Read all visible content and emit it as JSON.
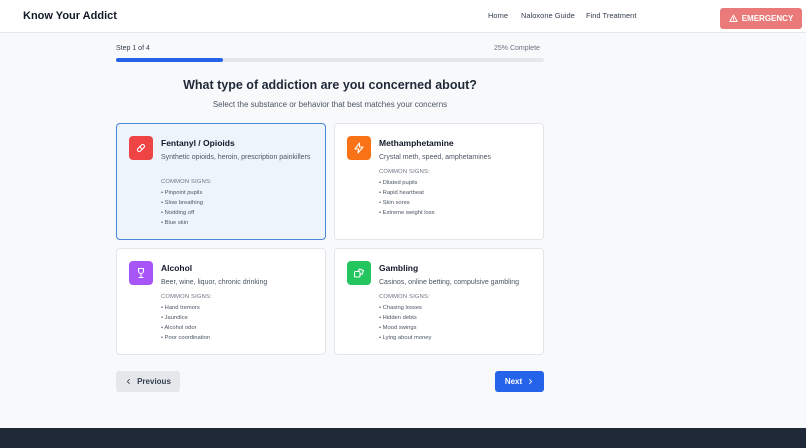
{
  "header": {
    "brand": "Know Your Addict",
    "nav": [
      "Home",
      "Naloxone Guide",
      "Find Treatment"
    ],
    "emergency_label": "EMERGENCY"
  },
  "progress": {
    "step_label": "Step 1 of 4",
    "percent_label": "25% Complete",
    "value": 0.25
  },
  "question": {
    "title": "What type of addiction are you concerned about?",
    "subtitle": "Select the substance or behavior that best matches your concerns"
  },
  "cards": [
    {
      "title": "Fentanyl / Opioids",
      "description": "Synthetic opioids, heroin, prescription painkillers",
      "signs_heading": "COMMON SIGNS:",
      "signs": [
        "• Pinpoint pupils",
        "• Slow breathing",
        "• Nodding off",
        "• Blue skin"
      ],
      "icon": "pill-icon",
      "color": "#ef4444",
      "selected": true
    },
    {
      "title": "Methamphetamine",
      "description": "Crystal meth, speed, amphetamines",
      "signs_heading": "COMMON SIGNS:",
      "signs": [
        "• Dilated pupils",
        "• Rapid heartbeat",
        "• Skin sores",
        "• Extreme weight loss"
      ],
      "icon": "lightning-icon",
      "color": "#f97316",
      "selected": false
    },
    {
      "title": "Alcohol",
      "description": "Beer, wine, liquor, chronic drinking",
      "signs_heading": "COMMON SIGNS:",
      "signs": [
        "• Hand tremors",
        "• Jaundice",
        "• Alcohol odor",
        "• Poor coordination"
      ],
      "icon": "wine-glass-icon",
      "color": "#a855f7",
      "selected": false
    },
    {
      "title": "Gambling",
      "description": "Casinos, online betting, compulsive gambling",
      "signs_heading": "COMMON SIGNS:",
      "signs": [
        "• Chasing losses",
        "• Hidden debts",
        "• Mood swings",
        "• Lying about money"
      ],
      "icon": "dice-icon",
      "color": "#22c55e",
      "selected": false
    }
  ],
  "buttons": {
    "previous": "Previous",
    "next": "Next"
  }
}
